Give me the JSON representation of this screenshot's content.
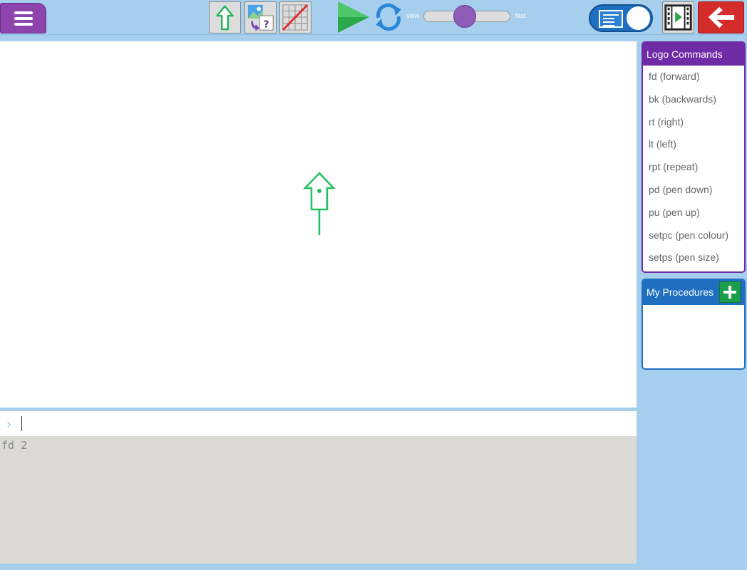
{
  "toolbar": {
    "speed": {
      "slow_label": "slow",
      "fast_label": "fast",
      "level": 0.45
    }
  },
  "canvas": {
    "turtle_color": "#20c060",
    "pen_down": true
  },
  "command_input": {
    "prompt_symbol": "›",
    "value": "",
    "placeholder": ""
  },
  "history": {
    "lines": [
      "fd 2"
    ]
  },
  "logo_commands": {
    "title": "Logo Commands",
    "items": [
      "fd (forward)",
      "bk (backwards)",
      "rt (right)",
      "lt (left)",
      "rpt (repeat)",
      "pd (pen down)",
      "pu (pen up)",
      "setpc (pen colour)",
      "setps (pen size)"
    ]
  },
  "procedures": {
    "title": "My Procedures",
    "items": []
  },
  "colors": {
    "background": "#a6cfee",
    "commands_accent": "#6f2aa6",
    "procedures_accent": "#1f6fc0",
    "run_green": "#2aa84a",
    "back_red": "#d42b2b"
  }
}
